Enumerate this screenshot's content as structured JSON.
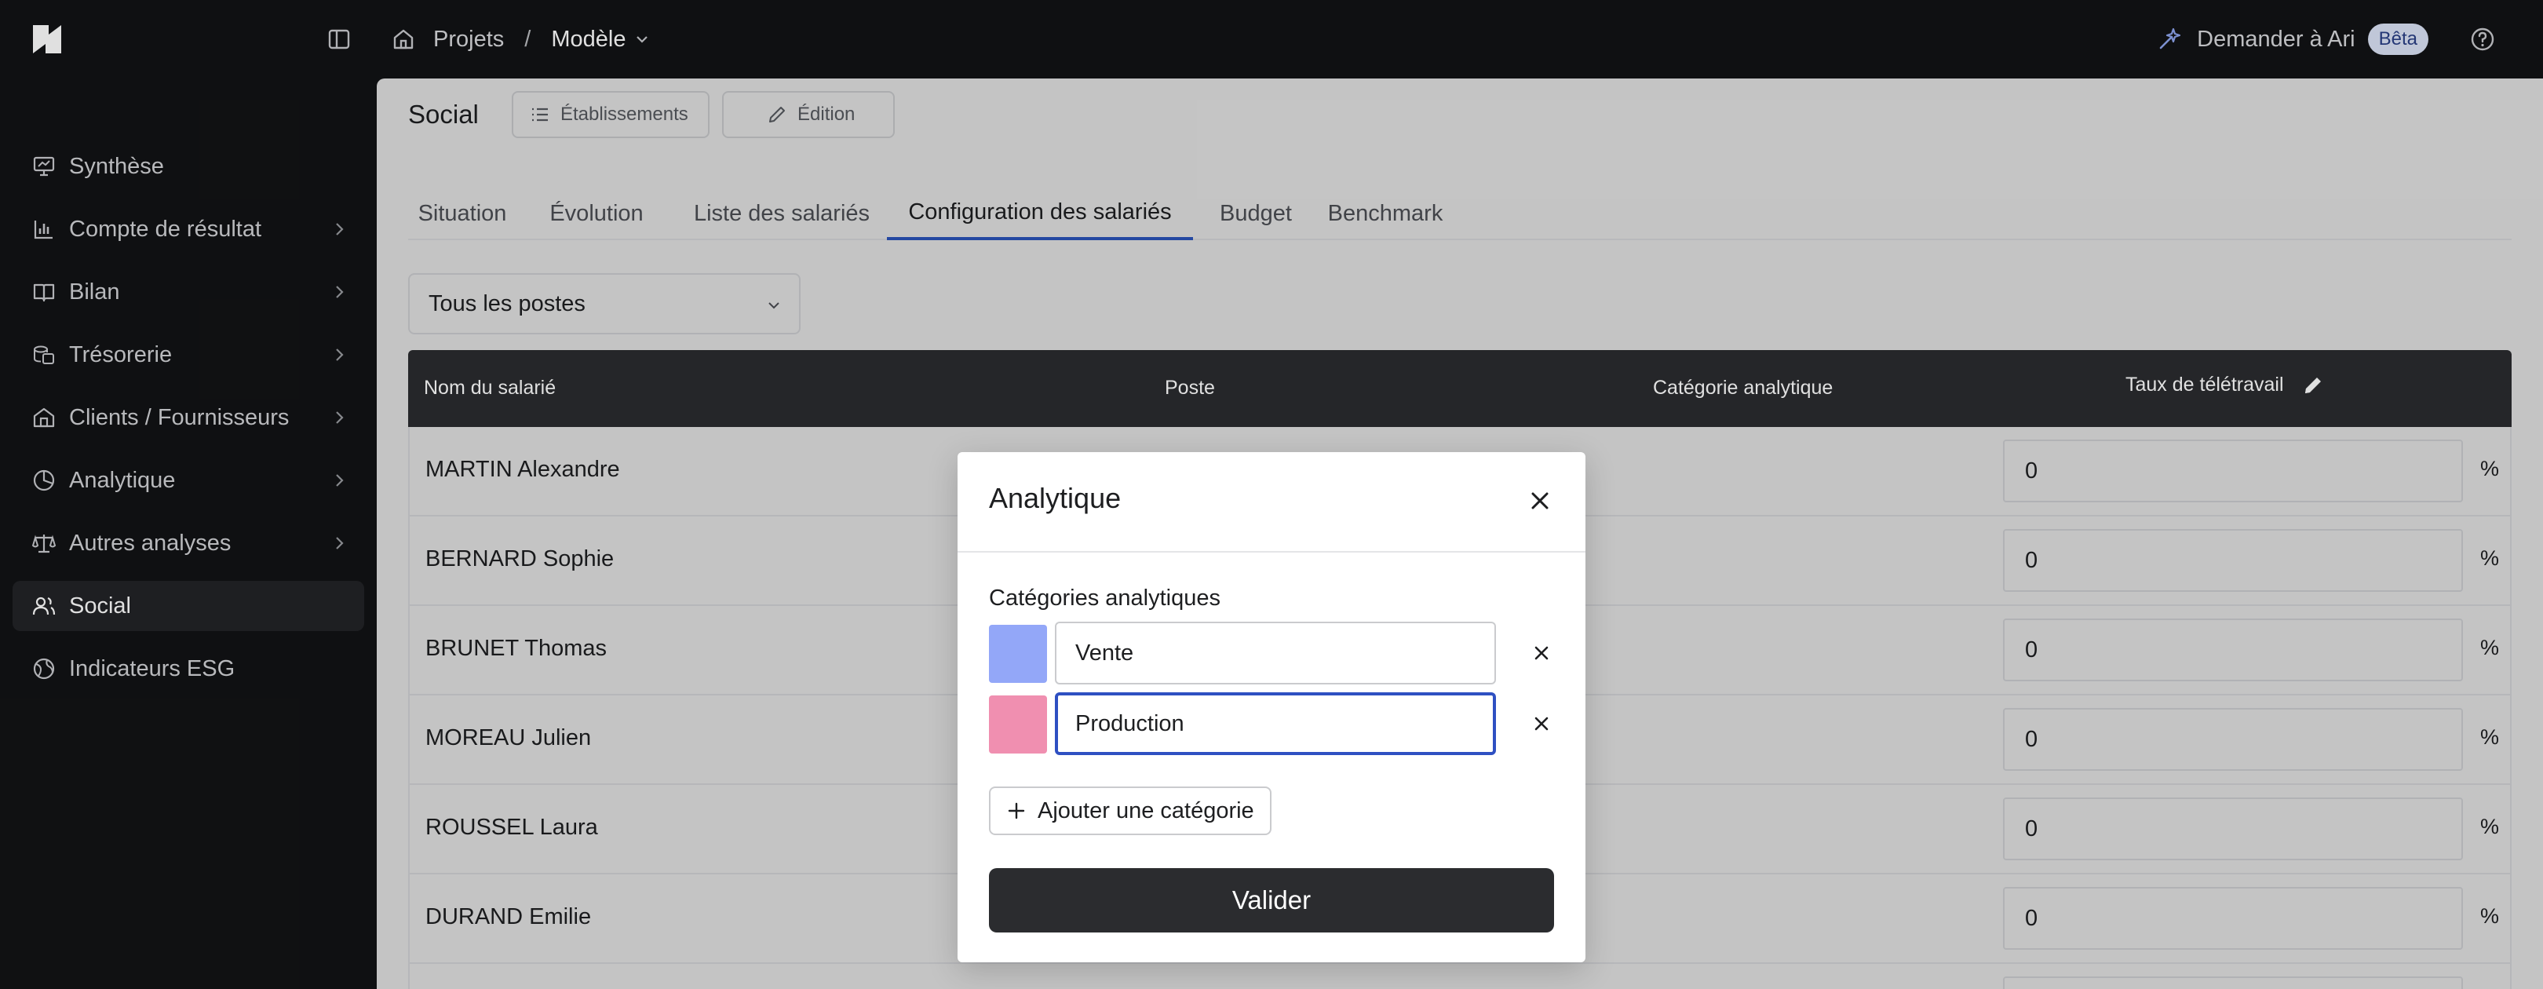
{
  "topbar": {
    "breadcrumb": {
      "projects": "Projets",
      "separator": "/",
      "current": "Modèle"
    },
    "ask_ari": "Demander à Ari",
    "beta_badge": "Bêta"
  },
  "sidebar": {
    "items": [
      {
        "label": "Synthèse",
        "icon": "presentation-icon",
        "has_arrow": false
      },
      {
        "label": "Compte de résultat",
        "icon": "bar-chart-icon",
        "has_arrow": true
      },
      {
        "label": "Bilan",
        "icon": "book-icon",
        "has_arrow": true
      },
      {
        "label": "Trésorerie",
        "icon": "coins-icon",
        "has_arrow": true
      },
      {
        "label": "Clients / Fournisseurs",
        "icon": "house-icon",
        "has_arrow": true
      },
      {
        "label": "Analytique",
        "icon": "pie-chart-icon",
        "has_arrow": true
      },
      {
        "label": "Autres analyses",
        "icon": "scale-icon",
        "has_arrow": true
      },
      {
        "label": "Social",
        "icon": "users-icon",
        "has_arrow": false,
        "active": true
      },
      {
        "label": "Indicateurs ESG",
        "icon": "globe-icon",
        "has_arrow": false
      }
    ]
  },
  "main": {
    "title": "Social",
    "header_buttons": {
      "establishments": "Établissements",
      "edit": "Édition"
    },
    "tabs": [
      {
        "label": "Situation"
      },
      {
        "label": "Évolution"
      },
      {
        "label": "Liste des salariés"
      },
      {
        "label": "Configuration des salariés",
        "active": true
      },
      {
        "label": "Budget"
      },
      {
        "label": "Benchmark"
      }
    ],
    "filter_select": {
      "value": "Tous les postes"
    },
    "table": {
      "columns": [
        "Nom du salarié",
        "Poste",
        "Catégorie analytique",
        "Taux de télétravail"
      ],
      "rows": [
        {
          "name": "MARTIN Alexandre",
          "telework": "0",
          "unit": "%"
        },
        {
          "name": "BERNARD Sophie",
          "telework": "0",
          "unit": "%"
        },
        {
          "name": "BRUNET Thomas",
          "telework": "0",
          "unit": "%"
        },
        {
          "name": "MOREAU Julien",
          "telework": "0",
          "unit": "%"
        },
        {
          "name": "ROUSSEL Laura",
          "telework": "0",
          "unit": "%"
        },
        {
          "name": "DURAND Emilie",
          "telework": "0",
          "unit": "%"
        }
      ]
    }
  },
  "modal": {
    "title": "Analytique",
    "section_label": "Catégories analytiques",
    "categories": [
      {
        "name": "Vente",
        "color": "#93a7f8"
      },
      {
        "name": "Production",
        "color": "#f08fb0"
      }
    ],
    "add_button": "Ajouter une catégorie",
    "submit_button": "Valider"
  },
  "colors": {
    "accent": "#2953b8",
    "dark": "#121315",
    "content_bg": "#e0e0e0"
  }
}
